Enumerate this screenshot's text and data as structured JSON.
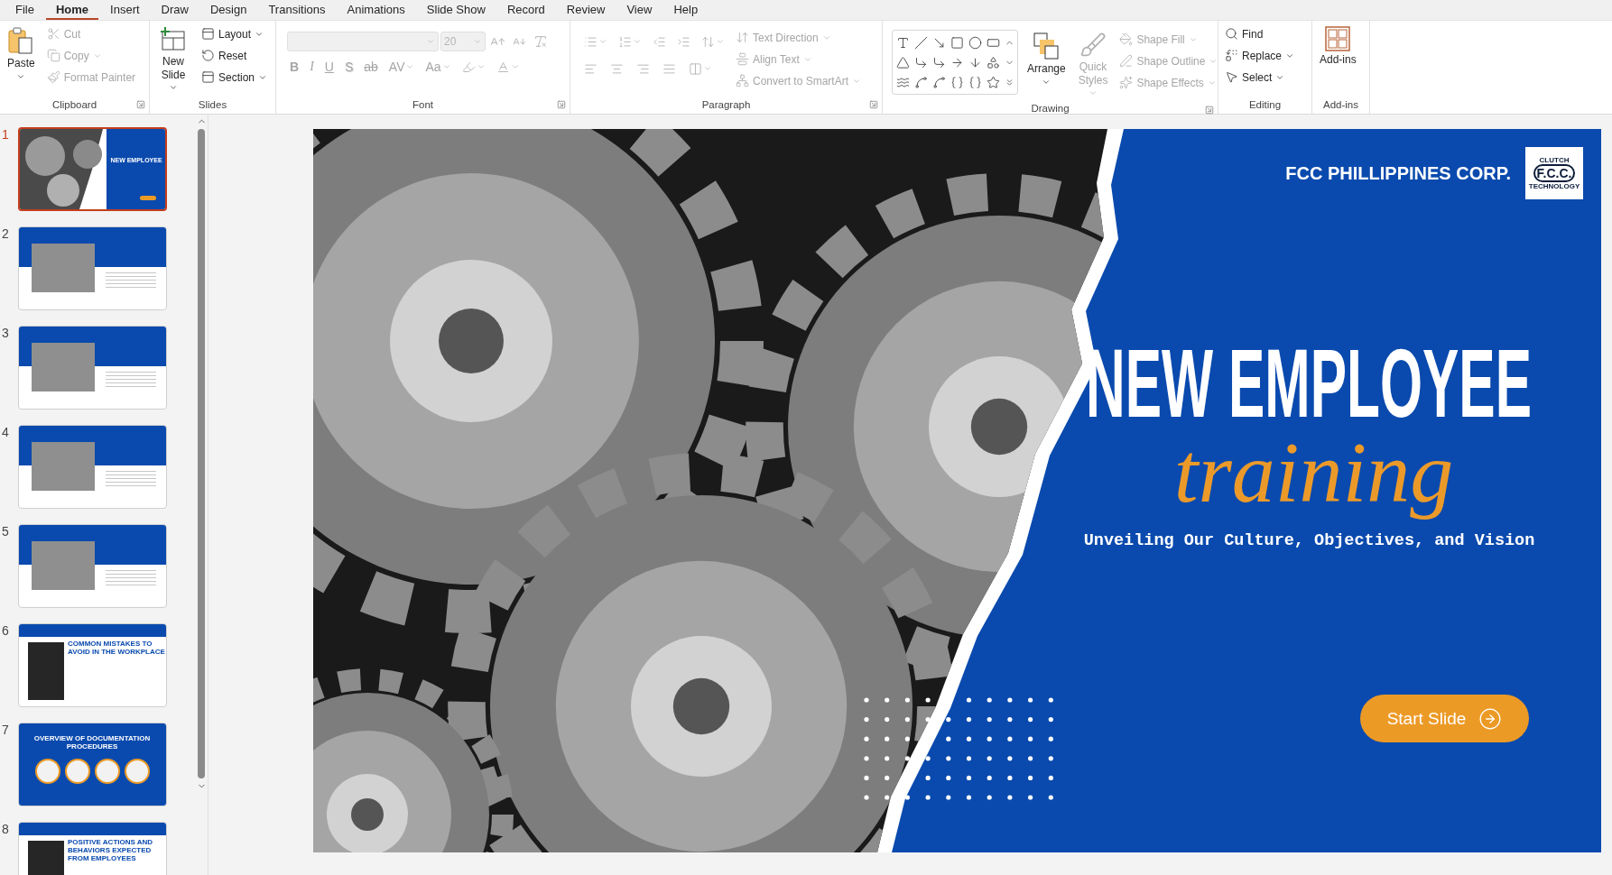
{
  "menu_tabs": [
    {
      "label": "File",
      "selected": false
    },
    {
      "label": "Home",
      "selected": true
    },
    {
      "label": "Insert",
      "selected": false
    },
    {
      "label": "Draw",
      "selected": false
    },
    {
      "label": "Design",
      "selected": false
    },
    {
      "label": "Transitions",
      "selected": false
    },
    {
      "label": "Animations",
      "selected": false
    },
    {
      "label": "Slide Show",
      "selected": false
    },
    {
      "label": "Record",
      "selected": false
    },
    {
      "label": "Review",
      "selected": false
    },
    {
      "label": "View",
      "selected": false
    },
    {
      "label": "Help",
      "selected": false
    }
  ],
  "ribbon": {
    "clipboard": {
      "label": "Clipboard",
      "paste": {
        "label": "Paste",
        "disabled": false
      },
      "cut": {
        "label": "Cut",
        "disabled": true
      },
      "copy": {
        "label": "Copy",
        "disabled": true
      },
      "format_painter": {
        "label": "Format Painter",
        "disabled": true
      }
    },
    "slides": {
      "label": "Slides",
      "new_slide": {
        "label": "New Slide",
        "disabled": false
      },
      "layout": {
        "label": "Layout",
        "disabled": false
      },
      "reset": {
        "label": "Reset",
        "disabled": false
      },
      "section": {
        "label": "Section",
        "disabled": false
      }
    },
    "font": {
      "label": "Font",
      "size": {
        "value": "20",
        "disabled": true
      },
      "format_buttons": [
        "B",
        "I",
        "U",
        "S",
        "ab",
        "AV",
        "Aa"
      ],
      "disabled": true
    },
    "paragraph": {
      "label": "Paragraph",
      "text_direction": {
        "label": "Text Direction",
        "disabled": true
      },
      "align_text": {
        "label": "Align Text",
        "disabled": true
      },
      "smartart": {
        "label": "Convert to SmartArt",
        "disabled": true
      }
    },
    "drawing": {
      "label": "Drawing",
      "arrange": {
        "label": "Arrange",
        "disabled": false
      },
      "quick_styles": {
        "label": "Quick Styles",
        "disabled": true
      },
      "shape_fill": {
        "label": "Shape Fill",
        "disabled": true
      },
      "shape_outline": {
        "label": "Shape Outline",
        "disabled": true
      },
      "shape_effects": {
        "label": "Shape Effects",
        "disabled": true
      }
    },
    "editing": {
      "label": "Editing",
      "find": {
        "label": "Find",
        "disabled": false
      },
      "replace": {
        "label": "Replace",
        "disabled": false
      },
      "select": {
        "label": "Select",
        "disabled": false
      }
    },
    "addins": {
      "label": "Add-ins",
      "button": {
        "label": "Add-ins",
        "disabled": false
      }
    }
  },
  "thumbnails": [
    {
      "number": "1",
      "selected": true,
      "kind": "cover",
      "title": "NEW EMPLOYEE"
    },
    {
      "number": "2",
      "selected": false,
      "kind": "split"
    },
    {
      "number": "3",
      "selected": false,
      "kind": "split"
    },
    {
      "number": "4",
      "selected": false,
      "kind": "split"
    },
    {
      "number": "5",
      "selected": false,
      "kind": "split"
    },
    {
      "number": "6",
      "selected": false,
      "kind": "banner",
      "title": "COMMON MISTAKES TO AVOID IN THE WORKPLACE"
    },
    {
      "number": "7",
      "selected": false,
      "kind": "grid",
      "title": "OVERVIEW OF DOCUMENTATION PROCEDURES"
    },
    {
      "number": "8",
      "selected": false,
      "kind": "banner",
      "title": "POSITIVE ACTIONS AND BEHAVIORS EXPECTED FROM EMPLOYEES"
    }
  ],
  "slide": {
    "company": "FCC PHILLIPPINES CORP.",
    "logo": {
      "top": "CLUTCH",
      "initials": "F.C.C.",
      "bottom": "TECHNOLOGY"
    },
    "title": "NEW EMPLOYEE",
    "script": "training",
    "subtitle": "Unveiling Our Culture, Objectives, and Vision",
    "button": "Start Slide"
  }
}
